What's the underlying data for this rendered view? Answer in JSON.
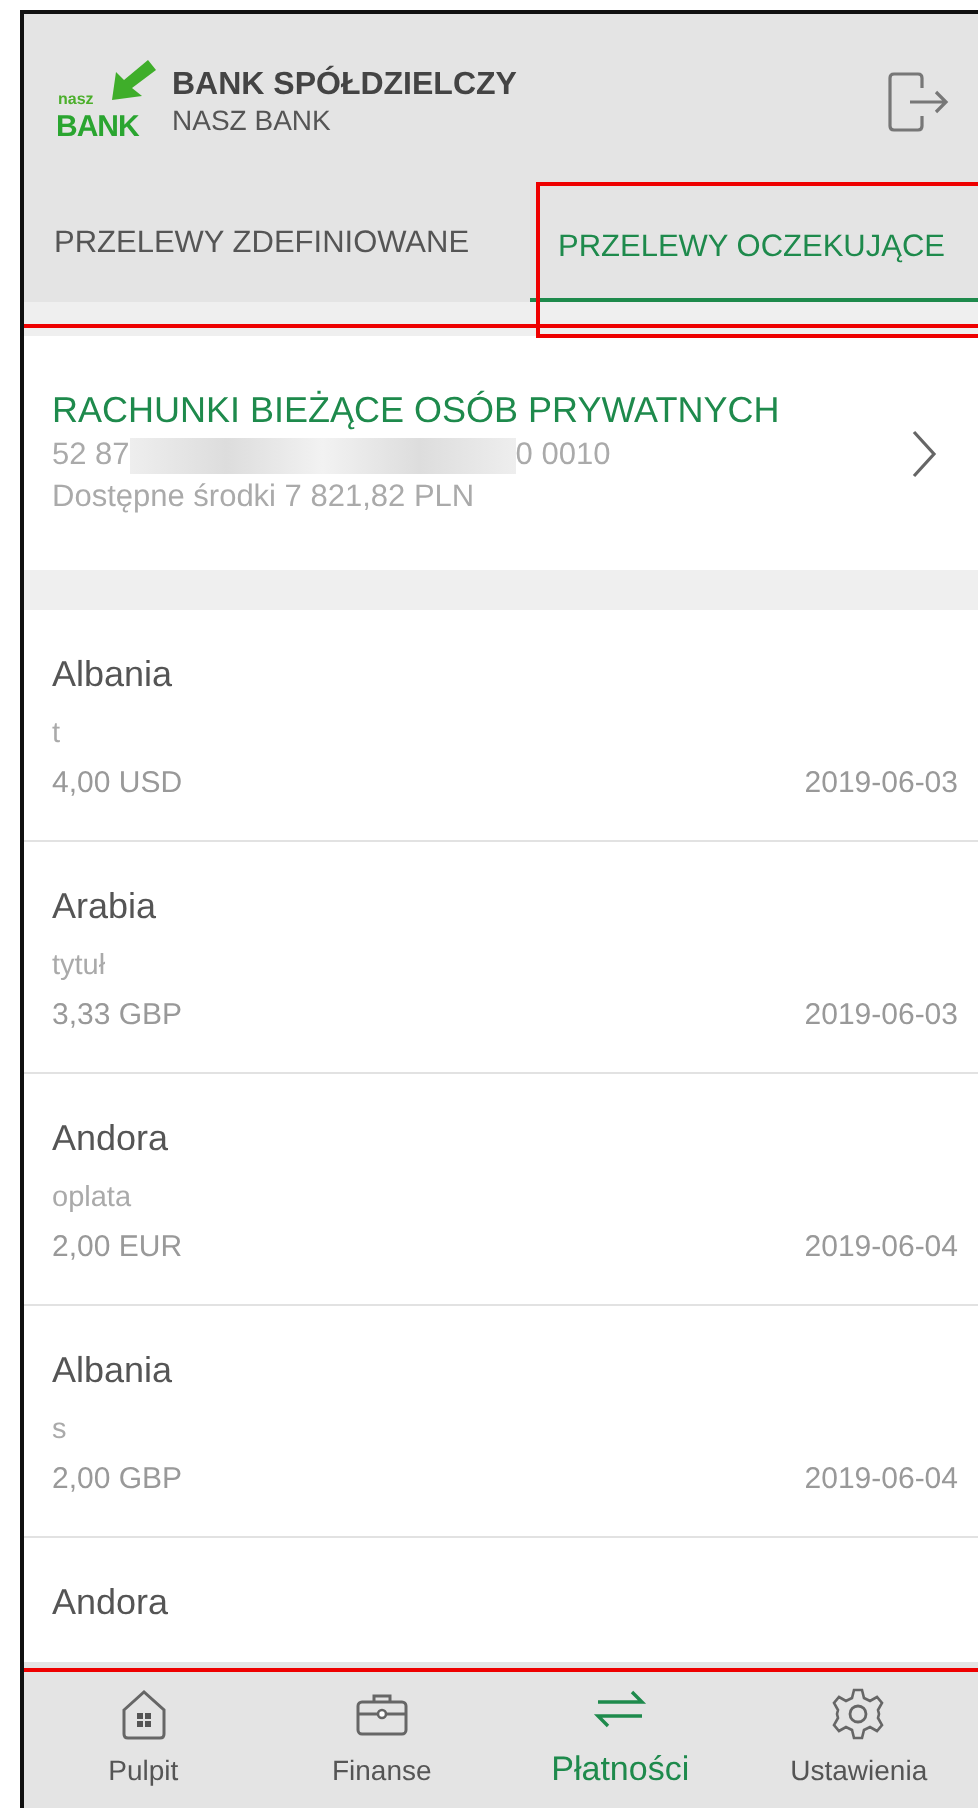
{
  "header": {
    "logo_small": "nasz",
    "logo_big": "BANK",
    "title": "BANK SPÓŁDZIELCZY",
    "subtitle": "NASZ BANK"
  },
  "tabs": [
    {
      "label": "PRZELEWY ZDEFINIOWANE",
      "selected": false
    },
    {
      "label": "PRZELEWY OCZEKUJĄCE",
      "selected": true
    }
  ],
  "account": {
    "name": "RACHUNKI BIEŻĄCE OSÓB PRYWATNYCH",
    "number_start": "52 87",
    "number_end": "0 0010",
    "balance": "Dostępne środki 7 821,82 PLN"
  },
  "transfers": [
    {
      "recipient": "Albania",
      "title": "t",
      "amount": "4,00 USD",
      "date": "2019-06-03"
    },
    {
      "recipient": "Arabia",
      "title": "tytuł",
      "amount": "3,33 GBP",
      "date": "2019-06-03"
    },
    {
      "recipient": "Andora",
      "title": "oplata",
      "amount": "2,00 EUR",
      "date": "2019-06-04"
    },
    {
      "recipient": "Albania",
      "title": "s",
      "amount": "2,00 GBP",
      "date": "2019-06-04"
    },
    {
      "recipient": "Andora"
    }
  ],
  "nav": [
    {
      "kind": "home",
      "label": "Pulpit",
      "selected": false
    },
    {
      "kind": "briefcase",
      "label": "Finanse",
      "selected": false
    },
    {
      "kind": "transfer",
      "label": "Płatności",
      "selected": true
    },
    {
      "kind": "gear",
      "label": "Ustawienia",
      "selected": false
    }
  ]
}
